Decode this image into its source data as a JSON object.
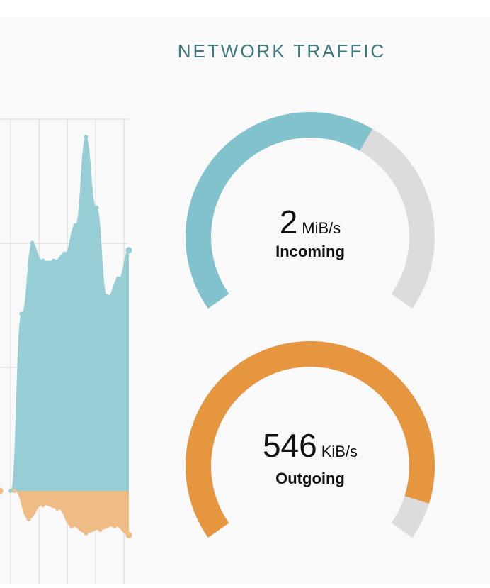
{
  "panel": {
    "title": "NETWORK TRAFFIC"
  },
  "colors": {
    "incoming": "#82c2cc",
    "incoming_area": "#97ced6",
    "outgoing": "#e5963f",
    "outgoing_area": "#eebc84",
    "track": "#dcdcdc",
    "title": "#3e7a80",
    "background": "#f9f9f9",
    "grid": "#d9d9d9"
  },
  "gauges": {
    "incoming": {
      "value": "2",
      "unit": "MiB/s",
      "label": "Incoming",
      "fill_fraction": 0.62
    },
    "outgoing": {
      "value": "546",
      "unit": "KiB/s",
      "label": "Outgoing",
      "fill_fraction": 0.93
    }
  },
  "chart_data": {
    "type": "area",
    "series": [
      {
        "values": [
          0,
          0,
          5,
          7,
          6.5,
          6.5,
          6.7,
          7.5,
          10,
          8,
          5.5,
          6,
          6.8
        ]
      },
      {
        "values": [
          0,
          0,
          -0.8,
          -0.4,
          -0.5,
          -1.0,
          -1.2,
          -1.1,
          -1.0,
          -1.25
        ]
      }
    ],
    "ylim": [
      -1.5,
      10.5
    ],
    "grid": true
  }
}
